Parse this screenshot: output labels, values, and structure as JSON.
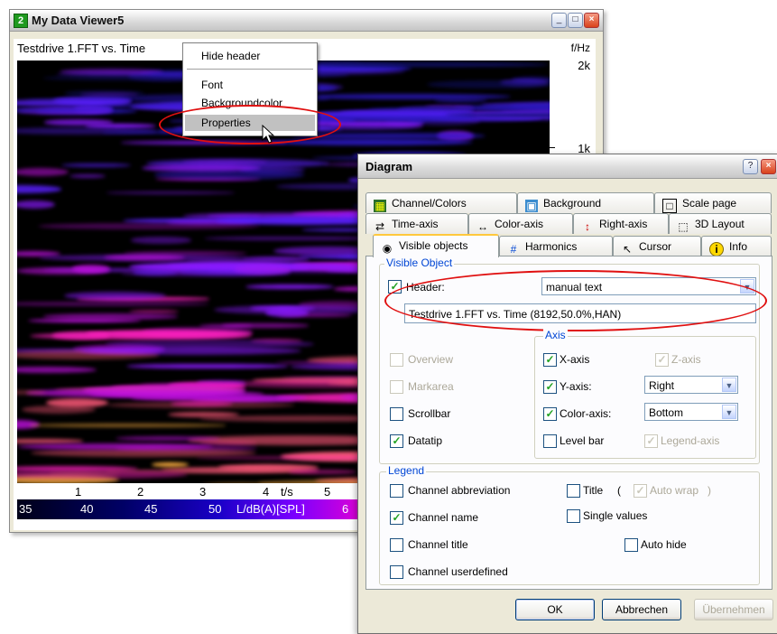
{
  "viewer": {
    "badge": "2",
    "title": "My Data Viewer5",
    "header_text": "Testdrive 1.FFT vs. Time",
    "y_unit": "f/Hz",
    "y_ticks": [
      "2k",
      "1k"
    ],
    "x_ticks": [
      "1",
      "2",
      "3",
      "4",
      "5"
    ],
    "x_unit": "t/s",
    "color_ticks": [
      "35",
      "40",
      "45",
      "50",
      "6"
    ],
    "color_label": "L/dB(A)[SPL]"
  },
  "context_menu": {
    "items": [
      "Hide header",
      "Font",
      "Backgroundcolor",
      "Properties"
    ]
  },
  "dialog": {
    "title": "Diagram",
    "tabs_row1": [
      {
        "label": "Channel/Colors",
        "icon": "palette-icon"
      },
      {
        "label": "Background",
        "icon": "picture-icon"
      },
      {
        "label": "Scale page",
        "icon": "square-icon"
      }
    ],
    "tabs_row2": [
      {
        "label": "Time-axis",
        "icon": "axes-icon"
      },
      {
        "label": "Color-axis",
        "icon": "double-arrow-icon"
      },
      {
        "label": "Right-axis",
        "icon": "vertical-arrows-icon"
      },
      {
        "label": "3D Layout",
        "icon": "cube-icon"
      }
    ],
    "tabs_row3": [
      {
        "label": "Visible objects",
        "icon": "eye-icon"
      },
      {
        "label": "Harmonics",
        "icon": "grid-icon"
      },
      {
        "label": "Cursor",
        "icon": "cursor-icon"
      },
      {
        "label": "Info",
        "icon": "info-icon"
      }
    ],
    "visible_object": {
      "group_label": "Visible Object",
      "header_label": "Header:",
      "header_mode": "manual text",
      "header_value": "Testdrive 1.FFT vs. Time (8192,50.0%,HAN)",
      "overview": "Overview",
      "markarea": "Markarea",
      "scrollbar": "Scrollbar",
      "datatip": "Datatip"
    },
    "axis": {
      "group_label": "Axis",
      "x_axis": "X-axis",
      "z_axis": "Z-axis",
      "y_axis": "Y-axis:",
      "y_axis_value": "Right",
      "color_axis": "Color-axis:",
      "color_axis_value": "Bottom",
      "level_bar": "Level bar",
      "legend_axis": "Legend-axis"
    },
    "legend": {
      "group_label": "Legend",
      "channel_abbreviation": "Channel abbreviation",
      "title": "Title",
      "paren_open": "(",
      "auto_wrap": "Auto wrap",
      "paren_close": ")",
      "channel_name": "Channel name",
      "single_values": "Single values",
      "channel_title": "Channel title",
      "auto_hide": "Auto hide",
      "channel_userdefined": "Channel userdefined"
    },
    "buttons": {
      "ok": "OK",
      "cancel": "Abbrechen",
      "apply": "Übernehmen"
    }
  }
}
